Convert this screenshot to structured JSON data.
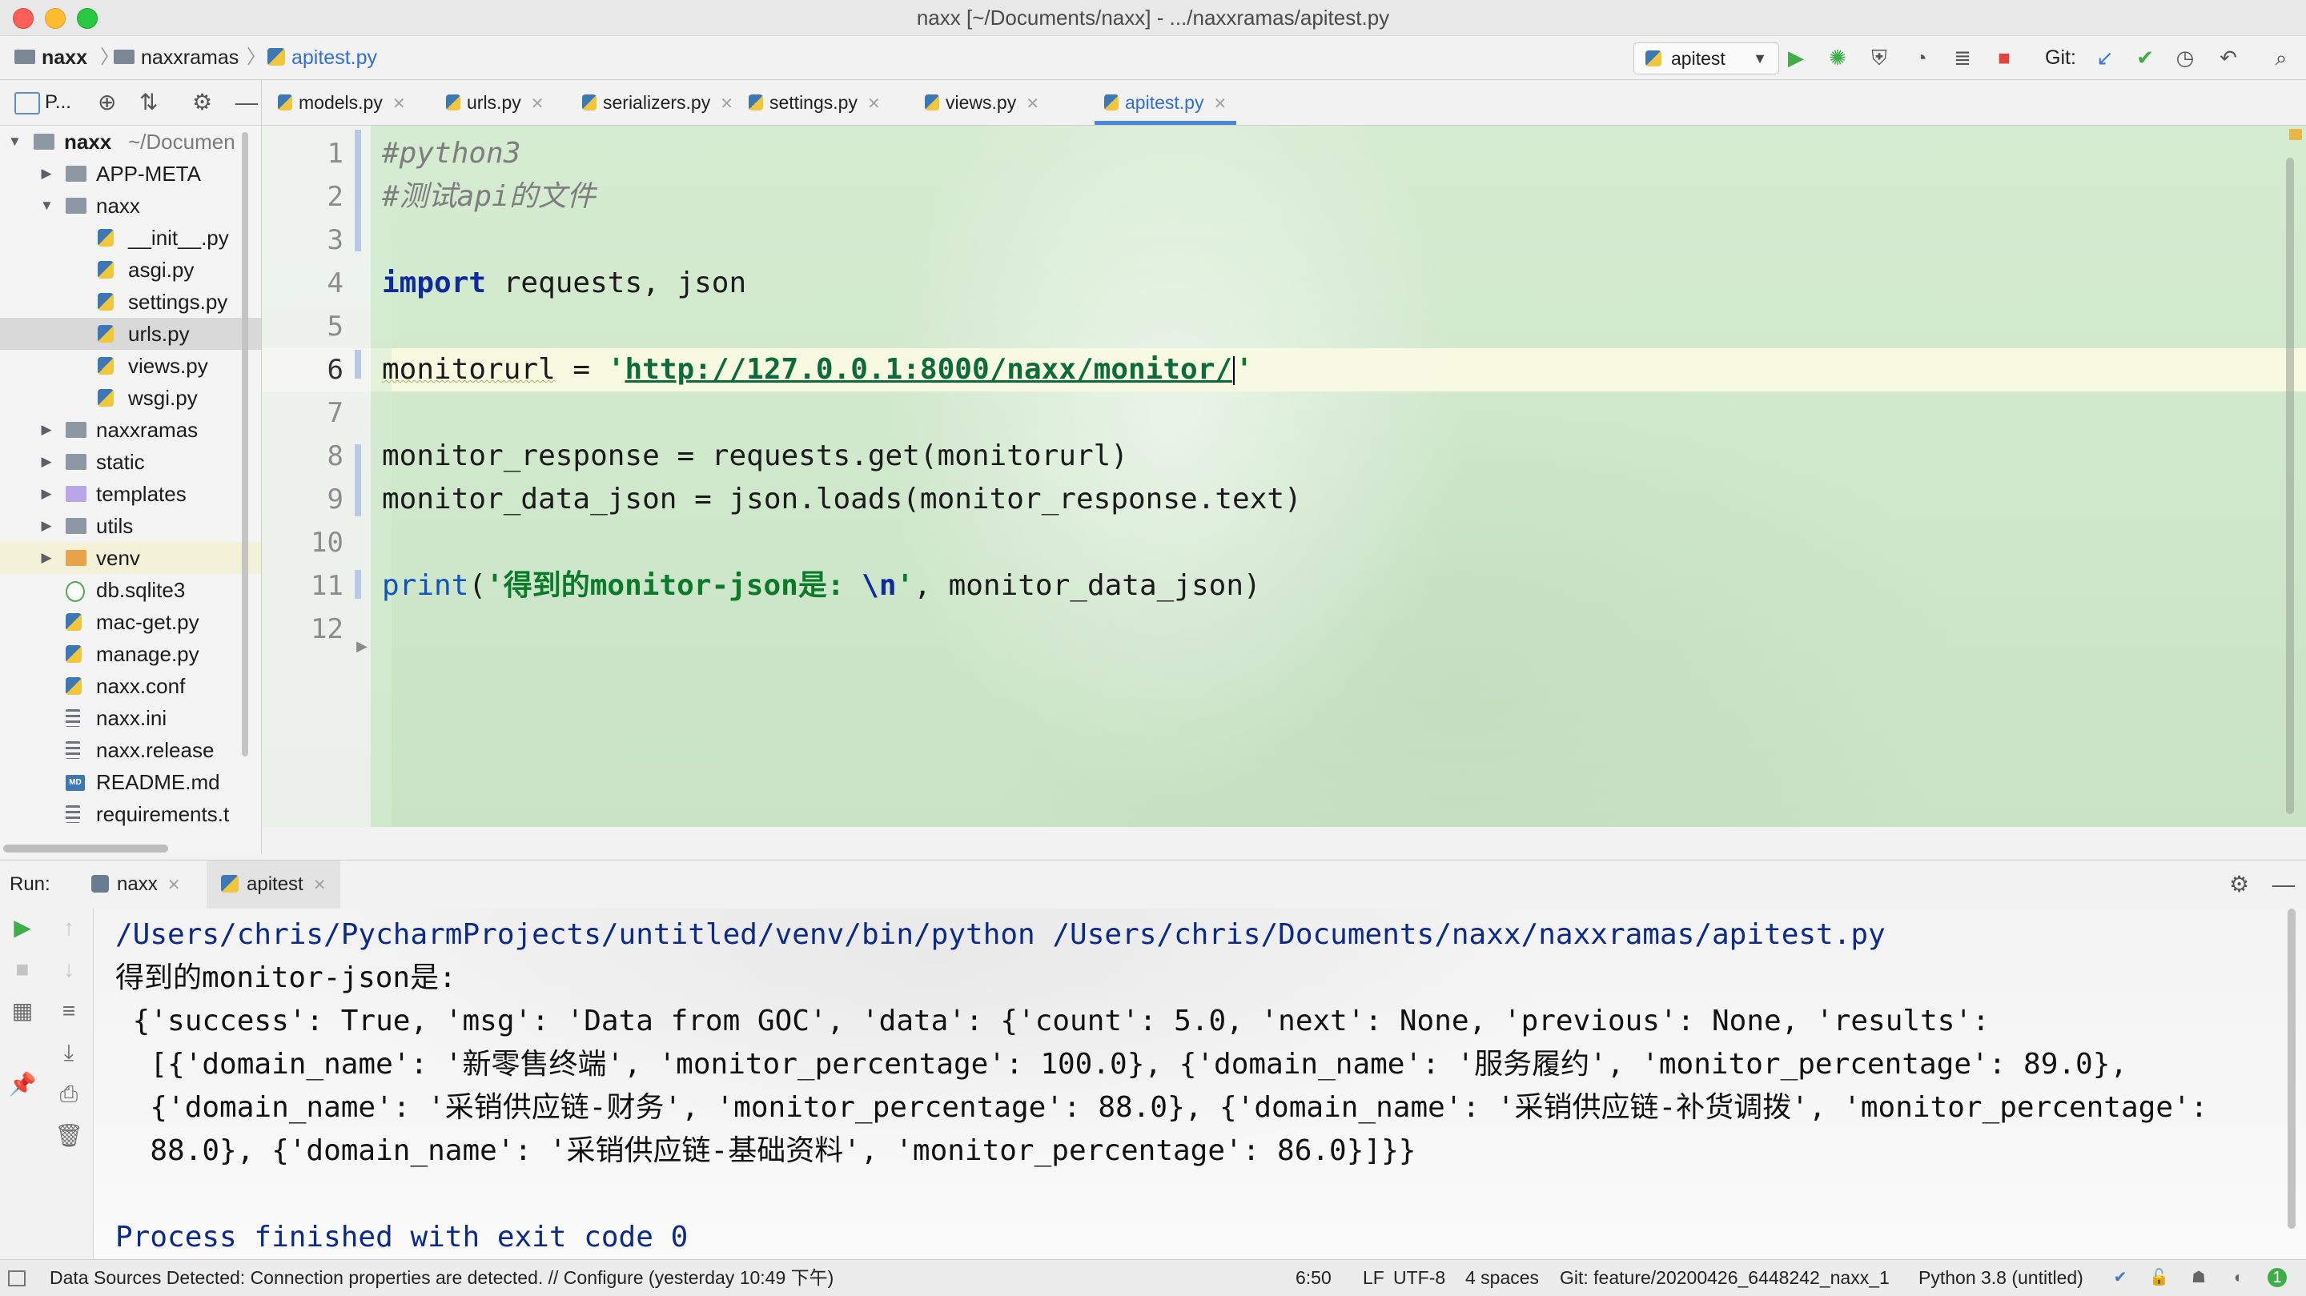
{
  "window": {
    "title": "naxx [~/Documents/naxx] - .../naxxramas/apitest.py"
  },
  "nav": {
    "breadcrumbs": [
      "naxx",
      "naxxramas",
      "apitest.py"
    ],
    "run_config": "apitest",
    "git_label": "Git:"
  },
  "project": {
    "title": "P...",
    "tree": [
      {
        "label": "naxx",
        "suffix": "~/Documen",
        "kind": "folder",
        "depth": 0,
        "expanded": true
      },
      {
        "label": "APP-META",
        "kind": "folder",
        "depth": 1,
        "expanded": false
      },
      {
        "label": "naxx",
        "kind": "folder",
        "depth": 1,
        "expanded": true
      },
      {
        "label": "__init__.py",
        "kind": "py",
        "depth": 2
      },
      {
        "label": "asgi.py",
        "kind": "py",
        "depth": 2
      },
      {
        "label": "settings.py",
        "kind": "py",
        "depth": 2
      },
      {
        "label": "urls.py",
        "kind": "py",
        "depth": 2,
        "selected": true
      },
      {
        "label": "views.py",
        "kind": "py",
        "depth": 2
      },
      {
        "label": "wsgi.py",
        "kind": "py",
        "depth": 2
      },
      {
        "label": "naxxramas",
        "kind": "folder",
        "depth": 1,
        "expanded": false
      },
      {
        "label": "static",
        "kind": "folder",
        "depth": 1,
        "expanded": false
      },
      {
        "label": "templates",
        "kind": "folder-purple",
        "depth": 1,
        "expanded": false
      },
      {
        "label": "utils",
        "kind": "folder",
        "depth": 1,
        "expanded": false
      },
      {
        "label": "venv",
        "kind": "folder-orange",
        "depth": 1,
        "expanded": false,
        "highlight": true
      },
      {
        "label": "db.sqlite3",
        "kind": "db",
        "depth": 1
      },
      {
        "label": "mac-get.py",
        "kind": "py",
        "depth": 1
      },
      {
        "label": "manage.py",
        "kind": "py",
        "depth": 1
      },
      {
        "label": "naxx.conf",
        "kind": "py",
        "depth": 1
      },
      {
        "label": "naxx.ini",
        "kind": "text",
        "depth": 1
      },
      {
        "label": "naxx.release",
        "kind": "text",
        "depth": 1
      },
      {
        "label": "README.md",
        "kind": "md",
        "depth": 1
      },
      {
        "label": "requirements.t",
        "kind": "text",
        "depth": 1
      }
    ]
  },
  "tabs": [
    {
      "label": "models.py"
    },
    {
      "label": "urls.py"
    },
    {
      "label": "serializers.py"
    },
    {
      "label": "settings.py"
    },
    {
      "label": "views.py"
    },
    {
      "label": "apitest.py",
      "active": true
    }
  ],
  "editor": {
    "current_line": 6,
    "lines": [
      {
        "n": "1",
        "parts": [
          {
            "t": "#python3",
            "c": "c-comment"
          }
        ]
      },
      {
        "n": "2",
        "parts": [
          {
            "t": "#测试api的文件",
            "c": "c-comment"
          }
        ]
      },
      {
        "n": "3",
        "parts": []
      },
      {
        "n": "4",
        "parts": [
          {
            "t": "import",
            "c": "c-kw"
          },
          {
            "t": " requests, json",
            "c": ""
          }
        ]
      },
      {
        "n": "5",
        "parts": []
      },
      {
        "n": "6",
        "parts": [
          {
            "t": "monitorurl",
            "c": "squig"
          },
          {
            "t": " = ",
            "c": ""
          },
          {
            "t": "'",
            "c": "c-str"
          },
          {
            "t": "http://127.0.0.1:8000/naxx/monitor/",
            "c": "c-url"
          },
          {
            "t": "|caret|",
            "c": "caret"
          },
          {
            "t": "'",
            "c": "c-str"
          }
        ]
      },
      {
        "n": "7",
        "parts": []
      },
      {
        "n": "8",
        "parts": [
          {
            "t": "monitor_response = requests.get(monitorurl)",
            "c": ""
          }
        ]
      },
      {
        "n": "9",
        "parts": [
          {
            "t": "monitor_data_json = json.loads(monitor_response.text)",
            "c": ""
          }
        ]
      },
      {
        "n": "10",
        "parts": []
      },
      {
        "n": "11",
        "parts": [
          {
            "t": "print",
            "c": "c-fn"
          },
          {
            "t": "(",
            "c": ""
          },
          {
            "t": "'得到的monitor-json是: ",
            "c": "c-str"
          },
          {
            "t": "\\n",
            "c": "c-esc"
          },
          {
            "t": "'",
            "c": "c-str"
          },
          {
            "t": ", monitor_data_json)",
            "c": ""
          }
        ]
      },
      {
        "n": "12",
        "parts": []
      }
    ]
  },
  "run": {
    "label": "Run:",
    "tabs": [
      {
        "label": "naxx"
      },
      {
        "label": "apitest",
        "active": true
      }
    ],
    "output": [
      {
        "text": "/Users/chris/PycharmProjects/untitled/venv/bin/python /Users/chris/Documents/naxx/naxxramas/apitest.py",
        "style": "blue"
      },
      {
        "text": "得到的monitor-json是:",
        "style": ""
      },
      {
        "text": " {'success': True, 'msg': 'Data from GOC', 'data': {'count': 5.0, 'next': None, 'previous': None, 'results':",
        "style": ""
      },
      {
        "text": "  [{'domain_name': '新零售终端', 'monitor_percentage': 100.0}, {'domain_name': '服务履约', 'monitor_percentage': 89.0},",
        "style": ""
      },
      {
        "text": "  {'domain_name': '采销供应链-财务', 'monitor_percentage': 88.0}, {'domain_name': '采销供应链-补货调拨', 'monitor_percentage':",
        "style": ""
      },
      {
        "text": "  88.0}, {'domain_name': '采销供应链-基础资料', 'monitor_percentage': 86.0}]}}",
        "style": ""
      },
      {
        "text": "",
        "style": ""
      },
      {
        "text": "Process finished with exit code 0",
        "style": "blue"
      }
    ]
  },
  "status": {
    "message": "Data Sources Detected: Connection properties are detected. // Configure (yesterday 10:49 下午)",
    "position": "6:50",
    "line_sep": "LF",
    "encoding": "UTF-8",
    "indent": "4 spaces",
    "branch": "Git: feature/20200426_6448242_naxx_1",
    "interpreter": "Python 3.8 (untitled)",
    "notifications": "1"
  },
  "colors": {
    "accent": "#4a87d8",
    "keyword": "#0d2b9e",
    "string": "#0b7a2a",
    "console_blue": "#0a2a8c",
    "run_green": "#3fae49",
    "stop_red": "#e0443e"
  }
}
